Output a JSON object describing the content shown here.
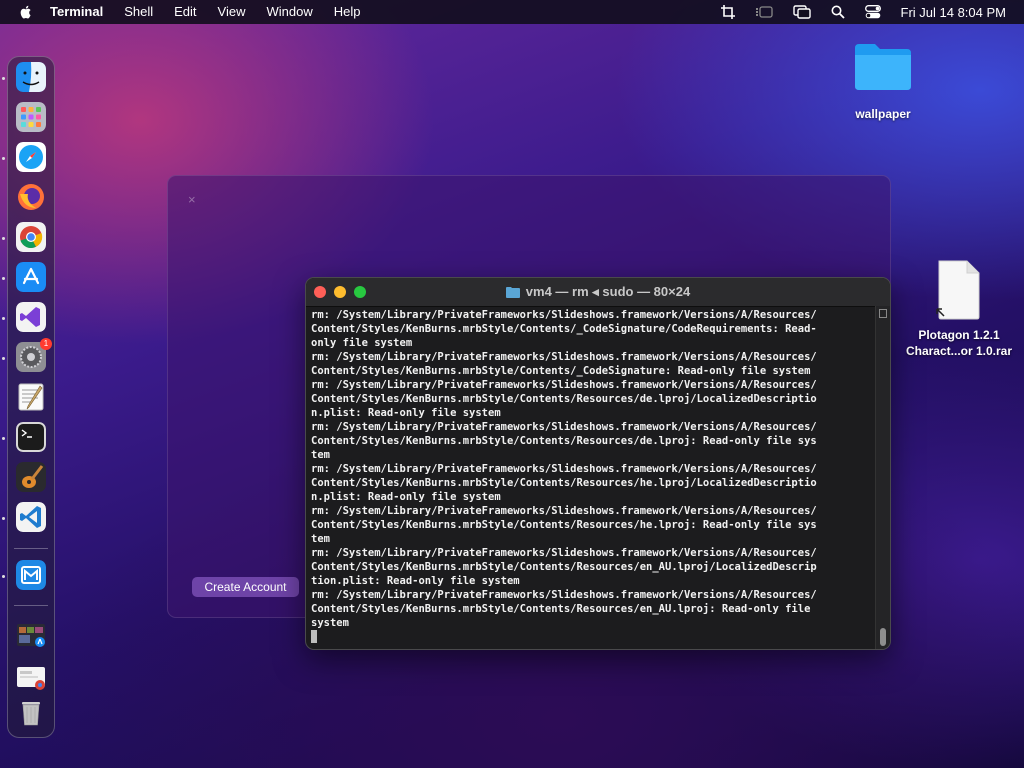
{
  "menubar": {
    "app_name": "Terminal",
    "items": [
      "Shell",
      "Edit",
      "View",
      "Window",
      "Help"
    ],
    "clock": "Fri Jul 14  8:04 PM"
  },
  "desktop": {
    "folder_label": "wallpaper",
    "file_label_line1": "Plotagon 1.2.1",
    "file_label_line2": "Charact...or 1.0.rar"
  },
  "background_window": {
    "close_glyph": "×",
    "button_label": "Create Account"
  },
  "terminal": {
    "title": "vm4 — rm ◂ sudo — 80×24",
    "lines": [
      "rm: /System/Library/PrivateFrameworks/Slideshows.framework/Versions/A/Resources/",
      "Content/Styles/KenBurns.mrbStyle/Contents/_CodeSignature/CodeRequirements: Read-",
      "only file system",
      "rm: /System/Library/PrivateFrameworks/Slideshows.framework/Versions/A/Resources/",
      "Content/Styles/KenBurns.mrbStyle/Contents/_CodeSignature: Read-only file system",
      "rm: /System/Library/PrivateFrameworks/Slideshows.framework/Versions/A/Resources/",
      "Content/Styles/KenBurns.mrbStyle/Contents/Resources/de.lproj/LocalizedDescriptio",
      "n.plist: Read-only file system",
      "rm: /System/Library/PrivateFrameworks/Slideshows.framework/Versions/A/Resources/",
      "Content/Styles/KenBurns.mrbStyle/Contents/Resources/de.lproj: Read-only file sys",
      "tem",
      "rm: /System/Library/PrivateFrameworks/Slideshows.framework/Versions/A/Resources/",
      "Content/Styles/KenBurns.mrbStyle/Contents/Resources/he.lproj/LocalizedDescriptio",
      "n.plist: Read-only file system",
      "rm: /System/Library/PrivateFrameworks/Slideshows.framework/Versions/A/Resources/",
      "Content/Styles/KenBurns.mrbStyle/Contents/Resources/he.lproj: Read-only file sys",
      "tem",
      "rm: /System/Library/PrivateFrameworks/Slideshows.framework/Versions/A/Resources/",
      "Content/Styles/KenBurns.mrbStyle/Contents/Resources/en_AU.lproj/LocalizedDescrip",
      "tion.plist: Read-only file system",
      "rm: /System/Library/PrivateFrameworks/Slideshows.framework/Versions/A/Resources/",
      "Content/Styles/KenBurns.mrbStyle/Contents/Resources/en_AU.lproj: Read-only file",
      "system"
    ]
  },
  "dock": {
    "settings_badge": "1",
    "apps": [
      "finder-icon",
      "launchpad-icon",
      "safari-icon",
      "firefox-icon",
      "chrome-icon",
      "app-store-icon",
      "visual-studio-icon",
      "system-settings-icon",
      "textedit-icon",
      "terminal-icon",
      "garageband-icon",
      "vscode-icon",
      "maxthon-icon",
      "screenshot-app-icon",
      "downloads-stack-icon",
      "trash-icon"
    ]
  },
  "colors": {
    "close": "#ff5f57",
    "minimize": "#febc2e",
    "zoom": "#28c840"
  }
}
